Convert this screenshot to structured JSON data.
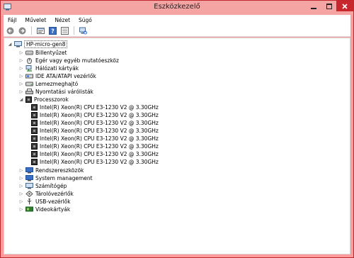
{
  "window": {
    "title": "Eszközkezelő"
  },
  "menu": [
    "Fájl",
    "Művelet",
    "Nézet",
    "Súgó"
  ],
  "toolbar": [
    "back-icon",
    "forward-icon",
    "properties-icon",
    "help-icon",
    "show-hidden-icon",
    "computer-scan-icon"
  ],
  "tree": {
    "root": "HP-micro-gen8",
    "categories_before": [
      {
        "label": "Billentyűzet",
        "icon": "keyboard-icon"
      },
      {
        "label": "Egér vagy egyéb mutatóeszköz",
        "icon": "mouse-icon"
      },
      {
        "label": "Hálózati kártyák",
        "icon": "network-adapter-icon"
      },
      {
        "label": "IDE ATA/ATAPI vezérlők",
        "icon": "ide-controller-icon"
      },
      {
        "label": "Lemezmeghajtó",
        "icon": "disk-drive-icon"
      },
      {
        "label": "Nyomtatási várólisták",
        "icon": "printer-icon"
      }
    ],
    "processors": {
      "label": "Processzorok",
      "icon": "processor-icon",
      "items": [
        "Intel(R) Xeon(R) CPU E3-1230 V2 @ 3.30GHz",
        "Intel(R) Xeon(R) CPU E3-1230 V2 @ 3.30GHz",
        "Intel(R) Xeon(R) CPU E3-1230 V2 @ 3.30GHz",
        "Intel(R) Xeon(R) CPU E3-1230 V2 @ 3.30GHz",
        "Intel(R) Xeon(R) CPU E3-1230 V2 @ 3.30GHz",
        "Intel(R) Xeon(R) CPU E3-1230 V2 @ 3.30GHz",
        "Intel(R) Xeon(R) CPU E3-1230 V2 @ 3.30GHz",
        "Intel(R) Xeon(R) CPU E3-1230 V2 @ 3.30GHz"
      ]
    },
    "categories_after": [
      {
        "label": "Rendszereszközök",
        "icon": "system-devices-icon"
      },
      {
        "label": "System management",
        "icon": "system-management-icon"
      },
      {
        "label": "Számítógép",
        "icon": "computer-icon"
      },
      {
        "label": "Tárolóvezérlők",
        "icon": "storage-controller-icon"
      },
      {
        "label": "USB-vezérlők",
        "icon": "usb-icon"
      },
      {
        "label": "Videokártyák",
        "icon": "display-adapter-icon"
      }
    ]
  }
}
